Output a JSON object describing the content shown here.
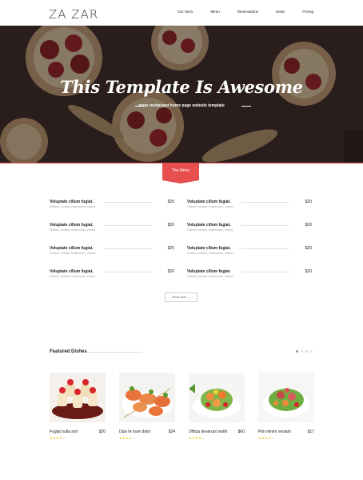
{
  "header": {
    "logo": "ZA ZAR",
    "nav": [
      "Our Story",
      "Menu",
      "Reservations",
      "News",
      "Pricing"
    ]
  },
  "hero": {
    "title": "This Template Is Awesome",
    "subtitle": "resto restaurant home page website template"
  },
  "menu": {
    "tab_label": "The Menu",
    "items": [
      {
        "name": "Voluptate cillum fugiat.",
        "desc": "Cheese, tomato, mushrooms, onions.",
        "price": "$20"
      },
      {
        "name": "Voluptate cillum fugiat.",
        "desc": "Cheese, tomato, mushrooms, onions.",
        "price": "$20"
      },
      {
        "name": "Voluptate cillum fugiat.",
        "desc": "Cheese, tomato, mushrooms, onions.",
        "price": "$20"
      },
      {
        "name": "Voluptate cillum fugiat.",
        "desc": "Cheese, tomato, mushrooms, onions.",
        "price": "$20"
      },
      {
        "name": "Voluptate cillum fugiat.",
        "desc": "Cheese, tomato, mushrooms, onions.",
        "price": "$20"
      },
      {
        "name": "Voluptate cillum fugiat.",
        "desc": "Cheese, tomato, mushrooms, onions.",
        "price": "$20"
      },
      {
        "name": "Voluptate cillum fugiat.",
        "desc": "Cheese, tomato, mushrooms, onions.",
        "price": "$20"
      },
      {
        "name": "Voluptate cillum fugiat.",
        "desc": "Cheese, tomato, mushrooms, onions.",
        "price": "$20"
      }
    ],
    "more_label": "Read more"
  },
  "featured": {
    "title": "Featured Dishes",
    "dishes": [
      {
        "name": "Fugiat nulla sint",
        "price": "$20",
        "stars": 4
      },
      {
        "name": "Duis te irure dolor",
        "price": "$24",
        "stars": 4
      },
      {
        "name": "Officia deserunt mollit",
        "price": "$60",
        "stars": 4
      },
      {
        "name": "Pim minim veniam",
        "price": "$17",
        "stars": 4
      }
    ]
  },
  "colors": {
    "accent": "#e8504f",
    "star": "#f2c200"
  }
}
